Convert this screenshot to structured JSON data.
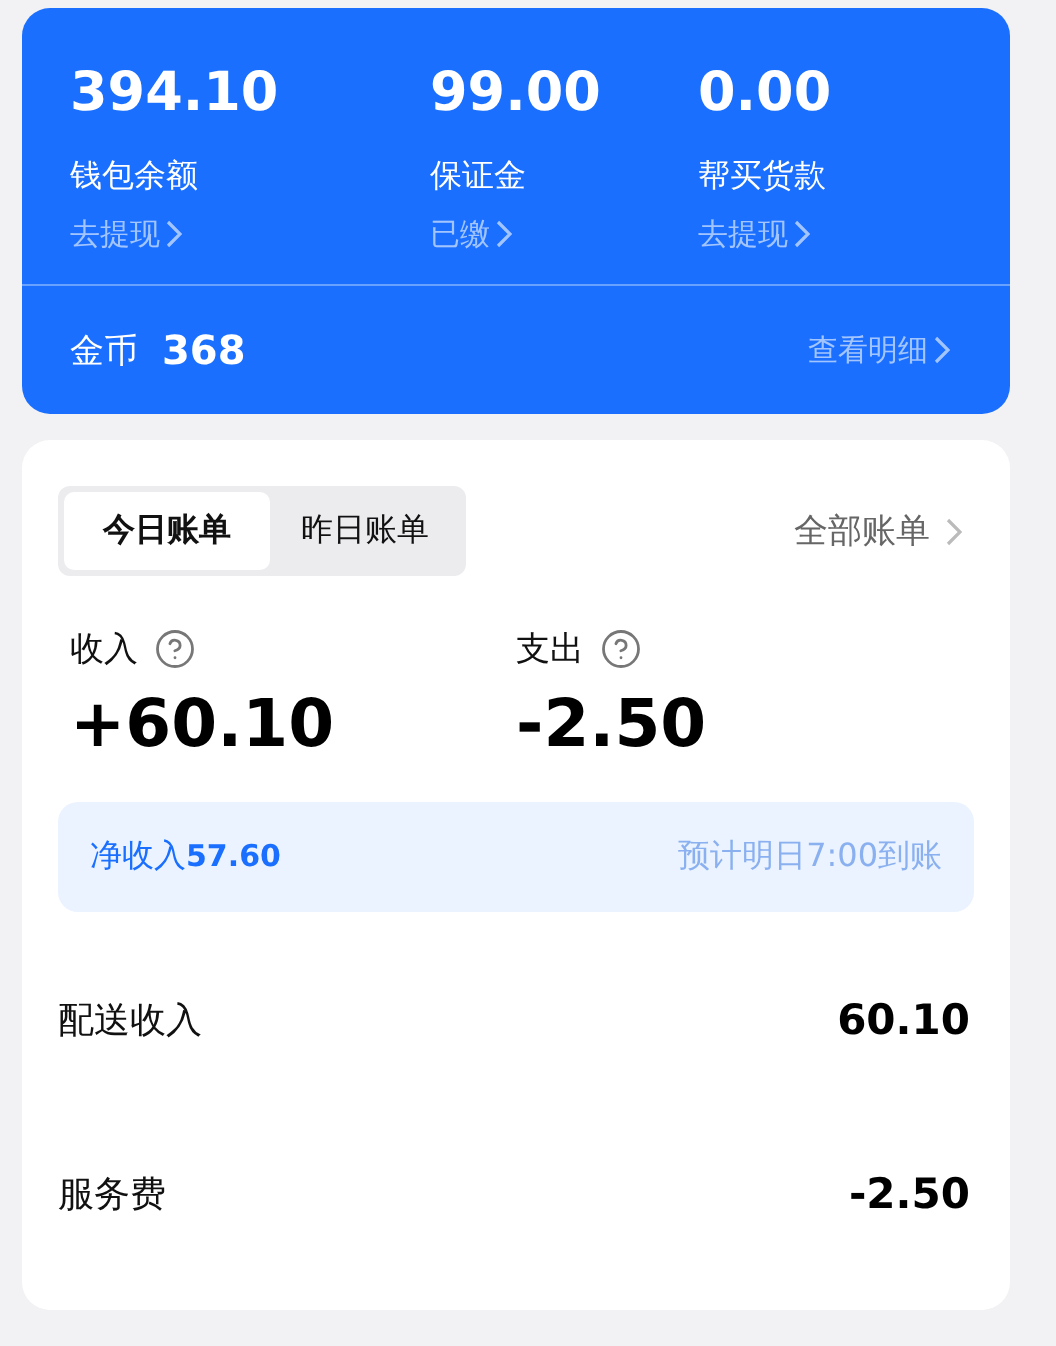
{
  "wallet": {
    "balances": [
      {
        "amount": "394.10",
        "label": "钱包余额",
        "link": "去提现"
      },
      {
        "amount": "99.00",
        "label": "保证金",
        "link": "已缴"
      },
      {
        "amount": "0.00",
        "label": "帮买货款",
        "link": "去提现"
      }
    ],
    "coins": {
      "label": "金币",
      "value": "368"
    },
    "detail_link": "查看明细"
  },
  "bill": {
    "tabs": [
      {
        "label": "今日账单",
        "selected": true
      },
      {
        "label": "昨日账单",
        "selected": false
      }
    ],
    "all_link": "全部账单",
    "summary": [
      {
        "label": "收入",
        "amount": "+60.10"
      },
      {
        "label": "支出",
        "amount": "-2.50"
      }
    ],
    "net": {
      "text": "净收入**57.60**",
      "note": "预计明日7:00到账"
    },
    "items": [
      {
        "label": "配送收入",
        "amount": "60.10"
      },
      {
        "label": "服务费",
        "amount": "-2.50"
      }
    ]
  }
}
